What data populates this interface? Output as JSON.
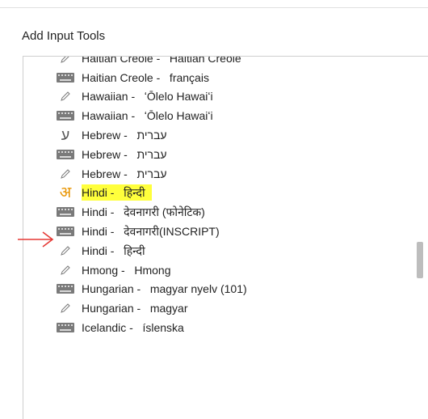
{
  "dialog": {
    "title": "Add Input Tools"
  },
  "colors": {
    "highlight": "#ffff3c",
    "arrow": "#e53935",
    "hindi_glyph": "#e89400"
  },
  "items": [
    {
      "icon": "pencil-icon",
      "label": "Haitian Creole -   Haitian Creole"
    },
    {
      "icon": "keyboard-icon",
      "label": "Haitian Creole -   français"
    },
    {
      "icon": "pencil-icon",
      "label": "Hawaiian -   ʻŌlelo Hawaiʻi"
    },
    {
      "icon": "keyboard-icon",
      "label": "Hawaiian -   ʻŌlelo Hawaiʻi"
    },
    {
      "icon": "hebrew-transliteration-icon",
      "glyph": "ע",
      "label": "Hebrew -   עברית"
    },
    {
      "icon": "keyboard-icon",
      "label": "Hebrew -   עברית"
    },
    {
      "icon": "pencil-icon",
      "label": "Hebrew -   עברית"
    },
    {
      "icon": "hindi-transliteration-icon",
      "glyph": "अ",
      "label": "Hindi -   हिन्दी",
      "highlighted": true
    },
    {
      "icon": "keyboard-icon",
      "label": "Hindi -   देवनागरी (फोनेटिक)"
    },
    {
      "icon": "keyboard-icon",
      "label": "Hindi -   देवनागरी(INSCRIPT)"
    },
    {
      "icon": "pencil-icon",
      "label": "Hindi -   हिन्दी"
    },
    {
      "icon": "pencil-icon",
      "label": "Hmong -   Hmong"
    },
    {
      "icon": "keyboard-icon",
      "label": "Hungarian -   magyar nyelv (101)"
    },
    {
      "icon": "pencil-icon",
      "label": "Hungarian -   magyar"
    },
    {
      "icon": "keyboard-icon",
      "label": "Icelandic -   íslenska"
    }
  ]
}
